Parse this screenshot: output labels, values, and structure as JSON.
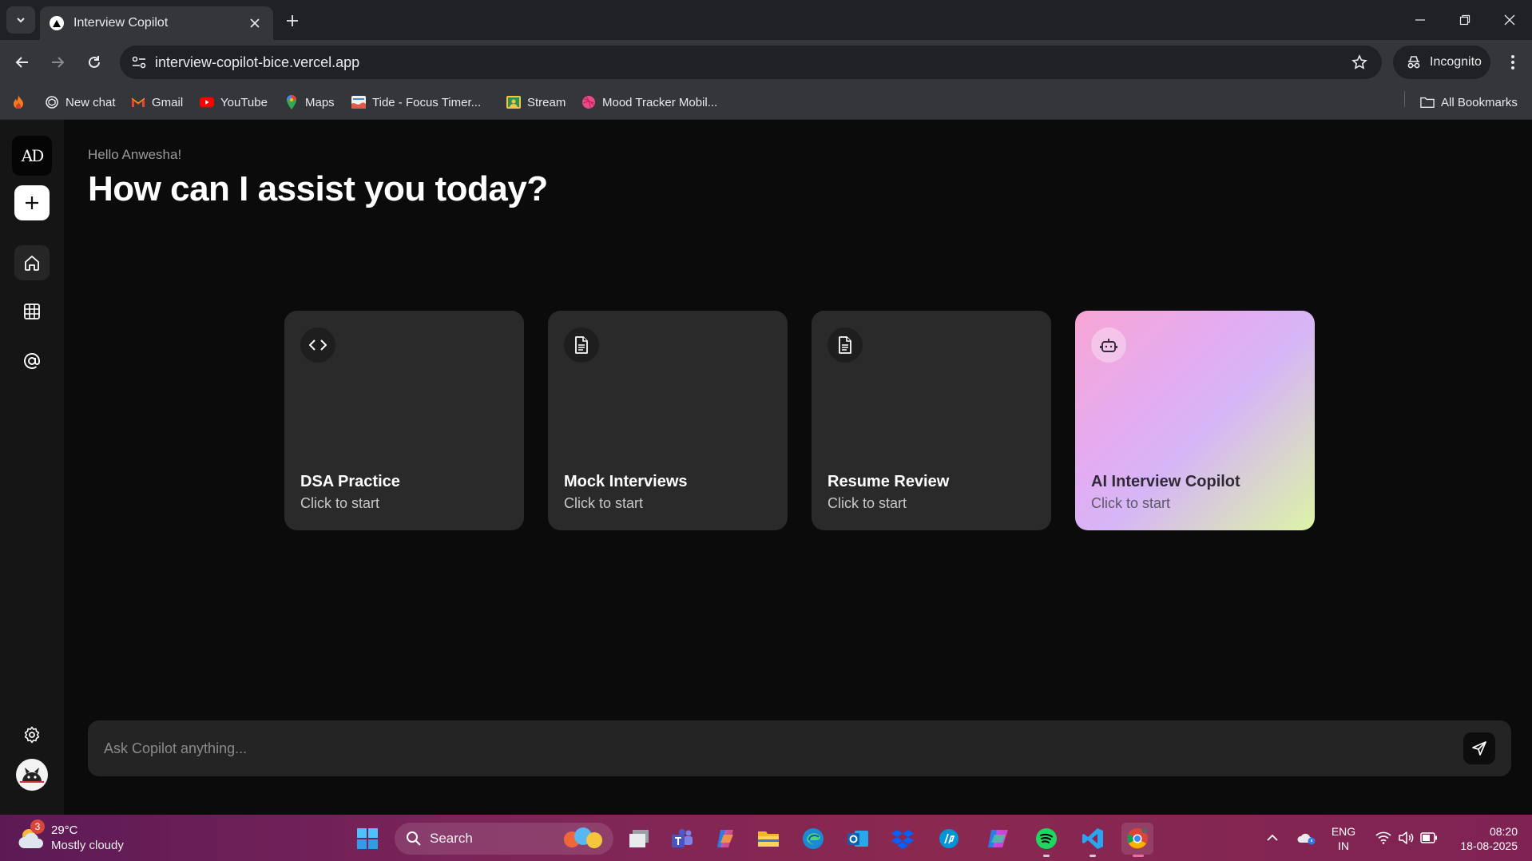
{
  "browser": {
    "tab_title": "Interview Copilot",
    "url": "interview-copilot-bice.vercel.app",
    "incognito_label": "Incognito"
  },
  "bookmarks": [
    {
      "label": "New chat",
      "icon": "chatgpt-icon"
    },
    {
      "label": "Gmail",
      "icon": "gmail-icon"
    },
    {
      "label": "YouTube",
      "icon": "youtube-icon"
    },
    {
      "label": "Maps",
      "icon": "maps-icon"
    },
    {
      "label": "Tide - Focus Timer...",
      "icon": "tide-icon"
    },
    {
      "label": "Stream",
      "icon": "stream-icon"
    },
    {
      "label": "Mood Tracker Mobil...",
      "icon": "dribbble-icon"
    }
  ],
  "all_bookmarks_label": "All Bookmarks",
  "app": {
    "logo_text": "AD",
    "greeting": "Hello Anwesha!",
    "headline": "How can I assist you today?",
    "cards": [
      {
        "title": "DSA Practice",
        "subtitle": "Click to start",
        "icon": "code-icon"
      },
      {
        "title": "Mock Interviews",
        "subtitle": "Click to start",
        "icon": "document-icon"
      },
      {
        "title": "Resume Review",
        "subtitle": "Click to start",
        "icon": "document-icon"
      },
      {
        "title": "AI Interview Copilot",
        "subtitle": "Click to start",
        "icon": "robot-icon"
      }
    ],
    "chat_placeholder": "Ask Copilot anything..."
  },
  "taskbar": {
    "weather_badge": "3",
    "temperature": "29°C",
    "condition": "Mostly cloudy",
    "search_label": "Search",
    "lang_line1": "ENG",
    "lang_line2": "IN",
    "time": "08:20",
    "date": "18-08-2025"
  },
  "colors": {
    "accent_gradient": [
      "#f8a6d4",
      "#e2acf3",
      "#dcf4a6"
    ],
    "background": "#0b0b0b",
    "card": "#2a2a2a"
  }
}
